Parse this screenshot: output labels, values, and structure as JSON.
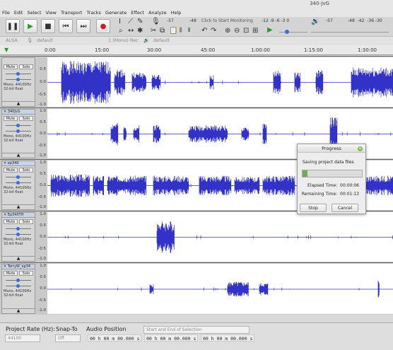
{
  "window": {
    "title": "340-JvG"
  },
  "menu": [
    "File",
    "Edit",
    "Select",
    "View",
    "Transport",
    "Tracks",
    "Generate",
    "Effect",
    "Analyze",
    "Help"
  ],
  "meters": {
    "record_ticks": [
      "-57",
      "-48"
    ],
    "monitor_hint": "Click to Start Monitoring",
    "record_ticks_right": [
      "-12",
      "-9",
      "-6",
      "-3",
      "0"
    ],
    "playback_ticks": [
      "-57",
      "-48",
      "-42",
      "-36",
      "-30"
    ],
    "lr_record": "L\nR",
    "lr_play": "L\nR"
  },
  "device": {
    "host": "ALSA",
    "rec_device": "default",
    "channels": "1 (Mono) Rec",
    "play_device": "default"
  },
  "ruler": [
    "0:00",
    "15:00",
    "30:00",
    "45:00",
    "1:00:00",
    "1:15:00",
    "1:30:00"
  ],
  "scale": [
    "1.0",
    "0.5",
    "0.0",
    "-0.5",
    "-1.0"
  ],
  "tracks": [
    {
      "name": "",
      "mute": "Mute",
      "solo": "Solo",
      "info": "Mono, 44100Hz\n32-bit float",
      "collapse": "▲",
      "lr": "L R"
    },
    {
      "name": "340JvG",
      "mute": "Mute",
      "solo": "Solo",
      "info": "Mono, 44100Hz\n32-bit float",
      "collapse": "▲",
      "lr": "L R"
    },
    {
      "name": "ep340",
      "mute": "Mute",
      "solo": "Solo",
      "info": "Mono, 44100Hz\n32-bit float",
      "collapse": "▲",
      "lr": "L R"
    },
    {
      "name": "Ep340TH",
      "mute": "Mute",
      "solo": "Solo",
      "info": "Mono, 44100Hz\n32-bit float",
      "collapse": "▲",
      "lr": "L R"
    },
    {
      "name": "TerryW_ep34",
      "mute": "Mute",
      "solo": "Solo",
      "info": "Mono, 44100Hz\n32-bit float",
      "collapse": "▲",
      "lr": "L R"
    }
  ],
  "progress": {
    "title": "Progress",
    "message": "Saving project data files",
    "elapsed_label": "Elapsed Time:",
    "elapsed": "00:00:06",
    "remaining_label": "Remaining Time:",
    "remaining": "00:01:13",
    "fraction": 0.08,
    "stop": "Stop",
    "cancel": "Cancel"
  },
  "bottom": {
    "rate_label": "Project Rate (Hz):",
    "rate_value": "44100",
    "snap_label": "Snap-To",
    "snap_value": "Off",
    "audio_pos_label": "Audio Position",
    "selection_mode": "Start and End of Selection",
    "time1": "00 h 00 m 00.000 s",
    "time2": "00 h 00 m 00.000 s",
    "time3": "00 h 00 m 00.000 s"
  },
  "colors": {
    "waveform": "#3232c8",
    "progress_fill": "#75a95a",
    "record": "#cc2020",
    "play": "#2a9a2a"
  }
}
